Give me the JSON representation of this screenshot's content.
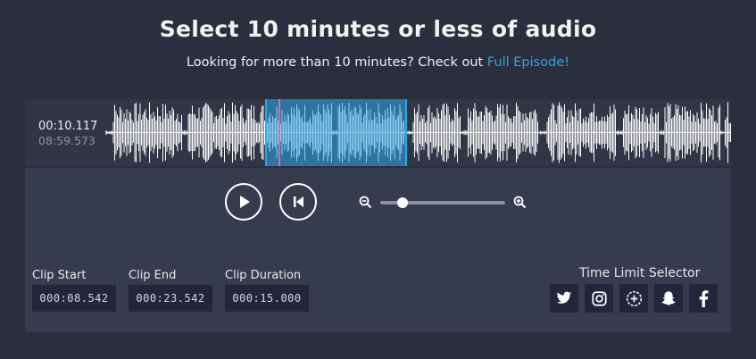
{
  "header": {
    "title": "Select 10 minutes or less of audio",
    "subtitle_text": "Looking for more than 10 minutes? Check out ",
    "subtitle_link": "Full Episode!"
  },
  "player": {
    "current_time": "00:10.117",
    "total_time": "08:59.573",
    "zoom_level": 0.18,
    "colors": {
      "accent": "#29a8e8",
      "playhead": "#d86aa8",
      "waveform": "#ffffff"
    },
    "icons": [
      "play-icon",
      "skip-back-icon",
      "zoom-out-icon",
      "zoom-in-icon"
    ]
  },
  "clip": {
    "start_label": "Clip Start",
    "start_value": "000:08.542",
    "end_label": "Clip End",
    "end_value": "000:23.542",
    "duration_label": "Clip Duration",
    "duration_value": "000:15.000"
  },
  "time_limit": {
    "label": "Time Limit Selector",
    "buttons": [
      "twitter-icon",
      "instagram-icon",
      "clock-plus-icon",
      "snapchat-icon",
      "facebook-icon"
    ]
  }
}
